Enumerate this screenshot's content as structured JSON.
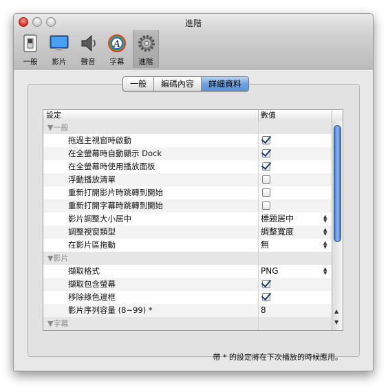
{
  "window": {
    "title": "進階"
  },
  "toolbar": {
    "items": [
      {
        "label": "一般",
        "icon": "switch-icon"
      },
      {
        "label": "影片",
        "icon": "monitor-icon"
      },
      {
        "label": "聲音",
        "icon": "speaker-icon"
      },
      {
        "label": "字幕",
        "icon": "font-icon"
      },
      {
        "label": "進階",
        "icon": "gear-icon",
        "selected": true
      }
    ]
  },
  "tabs": [
    {
      "label": "一般",
      "active": false
    },
    {
      "label": "編碼內容",
      "active": false
    },
    {
      "label": "詳細資料",
      "active": true
    }
  ],
  "table": {
    "columns": [
      "設定",
      "數值"
    ],
    "rows": [
      {
        "type": "group",
        "name": "▼一般"
      },
      {
        "type": "check",
        "name": "拖過主視窗時啟動",
        "checked": true
      },
      {
        "type": "check",
        "name": "在全螢幕時自動顯示 Dock",
        "checked": true
      },
      {
        "type": "check",
        "name": "在全螢幕時使用播放面板",
        "checked": true
      },
      {
        "type": "check",
        "name": "浮動播放清單",
        "checked": false
      },
      {
        "type": "check",
        "name": "重新打開影片時跳轉到開始",
        "checked": false
      },
      {
        "type": "check",
        "name": "重新打開字幕時跳轉到開始",
        "checked": false
      },
      {
        "type": "select",
        "name": "影片調整大小居中",
        "value": "標題居中"
      },
      {
        "type": "select",
        "name": "調整視窗類型",
        "value": "調整寬度"
      },
      {
        "type": "select",
        "name": "在影片區拖動",
        "value": "無"
      },
      {
        "type": "group",
        "name": "▼影片"
      },
      {
        "type": "select",
        "name": "擷取格式",
        "value": "PNG"
      },
      {
        "type": "check",
        "name": "擷取包含螢幕",
        "checked": true
      },
      {
        "type": "check",
        "name": "移除綠色邊框",
        "checked": true
      },
      {
        "type": "text",
        "name": "影片序列容量 (8~99) *",
        "value": "8"
      },
      {
        "type": "group",
        "name": "▼字幕"
      }
    ]
  },
  "footer": {
    "note": "帶 * 的設定將在下次播放的時候應用。"
  },
  "colors": {
    "accent": "#5a92da",
    "check": "#1f3c7a",
    "group_bg": "#e6e6e6"
  }
}
